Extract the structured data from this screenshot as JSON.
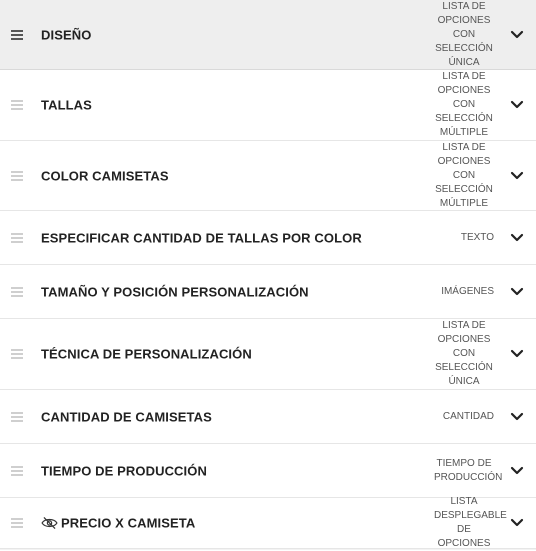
{
  "items": [
    {
      "title": "DISEÑO",
      "type_lines": [
        "LISTA DE",
        "OPCIONES",
        "CON",
        "SELECCIÓN",
        "ÚNICA"
      ],
      "active": true,
      "hidden": false,
      "icon": "drag-handle-icon"
    },
    {
      "title": "TALLAS",
      "type_lines": [
        "LISTA DE",
        "OPCIONES",
        "CON",
        "SELECCIÓN",
        "MÚLTIPLE"
      ],
      "active": false,
      "hidden": false,
      "icon": "drag-handle-icon"
    },
    {
      "title": "COLOR CAMISETAS",
      "type_lines": [
        "LISTA DE",
        "OPCIONES",
        "CON",
        "SELECCIÓN",
        "MÚLTIPLE"
      ],
      "active": false,
      "hidden": false,
      "icon": "drag-handle-icon"
    },
    {
      "title": "ESPECIFICAR CANTIDAD DE TALLAS POR COLOR",
      "type_lines": [
        "TEXTO"
      ],
      "active": false,
      "hidden": false,
      "icon": "drag-handle-icon"
    },
    {
      "title": "TAMAÑO Y POSICIÓN PERSONALIZACIÓN",
      "type_lines": [
        "IMÁGENES"
      ],
      "active": false,
      "hidden": false,
      "icon": "drag-handle-icon"
    },
    {
      "title": "TÉCNICA DE PERSONALIZACIÓN",
      "type_lines": [
        "LISTA DE",
        "OPCIONES",
        "CON",
        "SELECCIÓN",
        "ÚNICA"
      ],
      "active": false,
      "hidden": false,
      "icon": "drag-handle-icon"
    },
    {
      "title": "CANTIDAD DE CAMISETAS",
      "type_lines": [
        "CANTIDAD"
      ],
      "active": false,
      "hidden": false,
      "icon": "drag-handle-icon"
    },
    {
      "title": "TIEMPO DE PRODUCCIÓN",
      "type_lines": [
        "TIEMPO DE",
        "PRODUCCIÓN"
      ],
      "active": false,
      "hidden": false,
      "icon": "drag-handle-icon"
    },
    {
      "title": "PRECIO X CAMISETA",
      "type_lines": [
        "LISTA",
        "DESPLEGABLE",
        "DE OPCIONES"
      ],
      "active": false,
      "hidden": true,
      "icon": "drag-handle-icon"
    }
  ],
  "colors": {
    "active_row": "#eeeeee",
    "border": "#e6e6e6",
    "drag_idle": "#cfcfcf",
    "drag_active": "#555555"
  }
}
